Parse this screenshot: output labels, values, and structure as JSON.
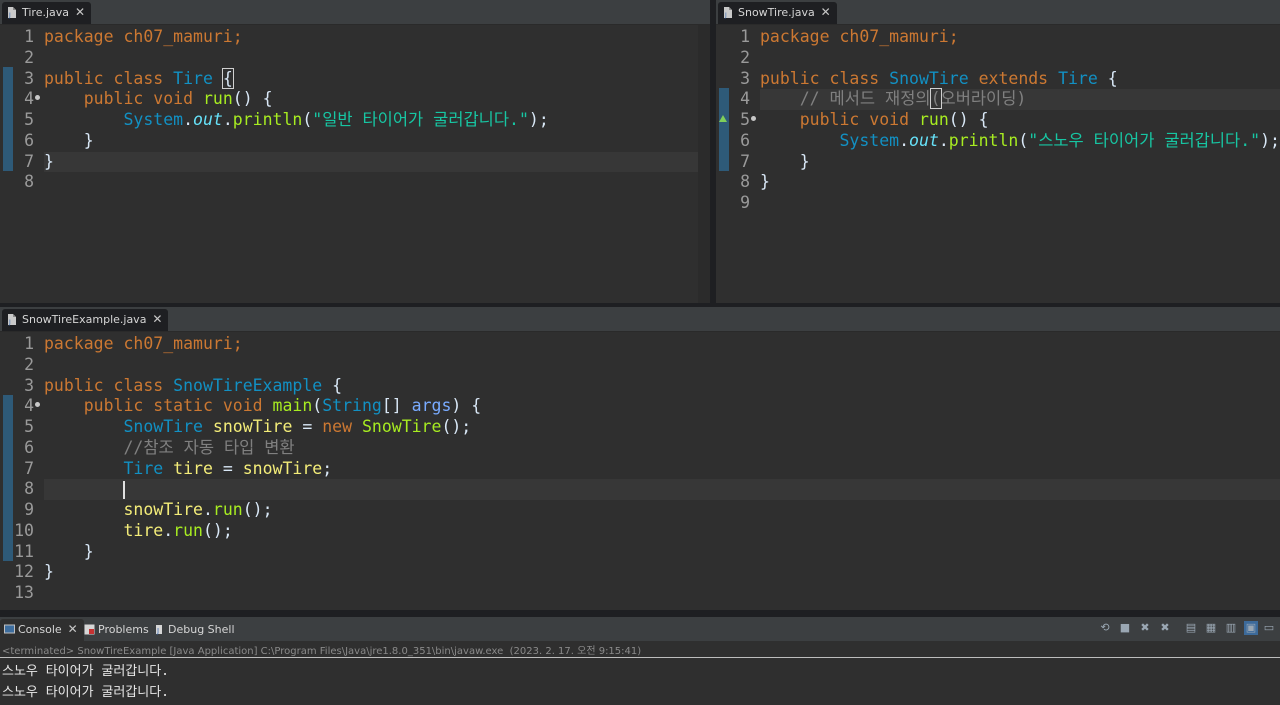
{
  "editors": {
    "tire": {
      "tab_title": "Tire.java",
      "close_glyph": "✕",
      "line_numbers": [
        "1",
        "2",
        "3",
        "4",
        "5",
        "6",
        "7",
        "8"
      ],
      "package": "package ch07_mamuri;",
      "class_decl": [
        "public",
        "class",
        "Tire",
        "{"
      ],
      "method_decl": [
        "public",
        "void",
        "run",
        "() {"
      ],
      "println": [
        "System",
        ".",
        "out",
        ".",
        "println",
        "(",
        "\"일반 타이어가 굴러갑니다.\"",
        ");"
      ],
      "close_method": "}",
      "close_class": "}"
    },
    "snowtire": {
      "tab_title": "SnowTire.java",
      "close_glyph": "✕",
      "line_numbers": [
        "1",
        "2",
        "3",
        "4",
        "5",
        "6",
        "7",
        "8",
        "9"
      ],
      "package": "package ch07_mamuri;",
      "class_decl": [
        "public",
        "class",
        "SnowTire",
        "extends",
        "Tire",
        "{"
      ],
      "comment": [
        "// 메서드 재정의",
        "(",
        "오버라이딩)"
      ],
      "method_decl": [
        "public",
        "void",
        "run",
        "() {"
      ],
      "println": [
        "System",
        ".",
        "out",
        ".",
        "println",
        "(",
        "\"스노우 타이어가 굴러갑니다.\"",
        ");"
      ],
      "close_method": "}",
      "close_class": "}"
    },
    "example": {
      "tab_title": "SnowTireExample.java",
      "close_glyph": "✕",
      "line_numbers": [
        "1",
        "2",
        "3",
        "4",
        "5",
        "6",
        "7",
        "8",
        "9",
        "10",
        "11",
        "12",
        "13"
      ],
      "package": "package ch07_mamuri;",
      "class_decl": [
        "public",
        "class",
        "SnowTireExample",
        "{"
      ],
      "main_decl": [
        "public",
        "static",
        "void",
        "main",
        "(",
        "String",
        "[] ",
        "args",
        ") {"
      ],
      "line5": [
        "SnowTire",
        "snowTire",
        " = ",
        "new",
        "SnowTire",
        "();"
      ],
      "line6": "//참조 자동 타입 변환",
      "line7": [
        "Tire",
        "tire",
        " = ",
        "snowTire",
        ";"
      ],
      "line9": [
        "snowTire",
        ".",
        "run",
        "();"
      ],
      "line10": [
        "tire",
        ".",
        "run",
        "();"
      ],
      "close_method": "}",
      "close_class": "}"
    }
  },
  "console": {
    "tabs": [
      {
        "label": "Console",
        "icon": "console-icon"
      },
      {
        "label": "Problems",
        "icon": "problems-icon"
      },
      {
        "label": "Debug Shell",
        "icon": "debug-shell-icon"
      }
    ],
    "close_glyph": "✕",
    "status": "<terminated> SnowTireExample [Java Application] C:\\Program Files\\Java\\jre1.8.0_351\\bin\\javaw.exe  (2023. 2. 17. 오전 9:15:41)",
    "output": [
      "스노우 타이어가 굴러갑니다.",
      "스노우 타이어가 굴러갑니다."
    ]
  },
  "colors": {
    "keyword": "#cc7832",
    "type": "#1290c3",
    "method": "#a7ec21",
    "string": "#17c6a3",
    "comment": "#808080"
  }
}
